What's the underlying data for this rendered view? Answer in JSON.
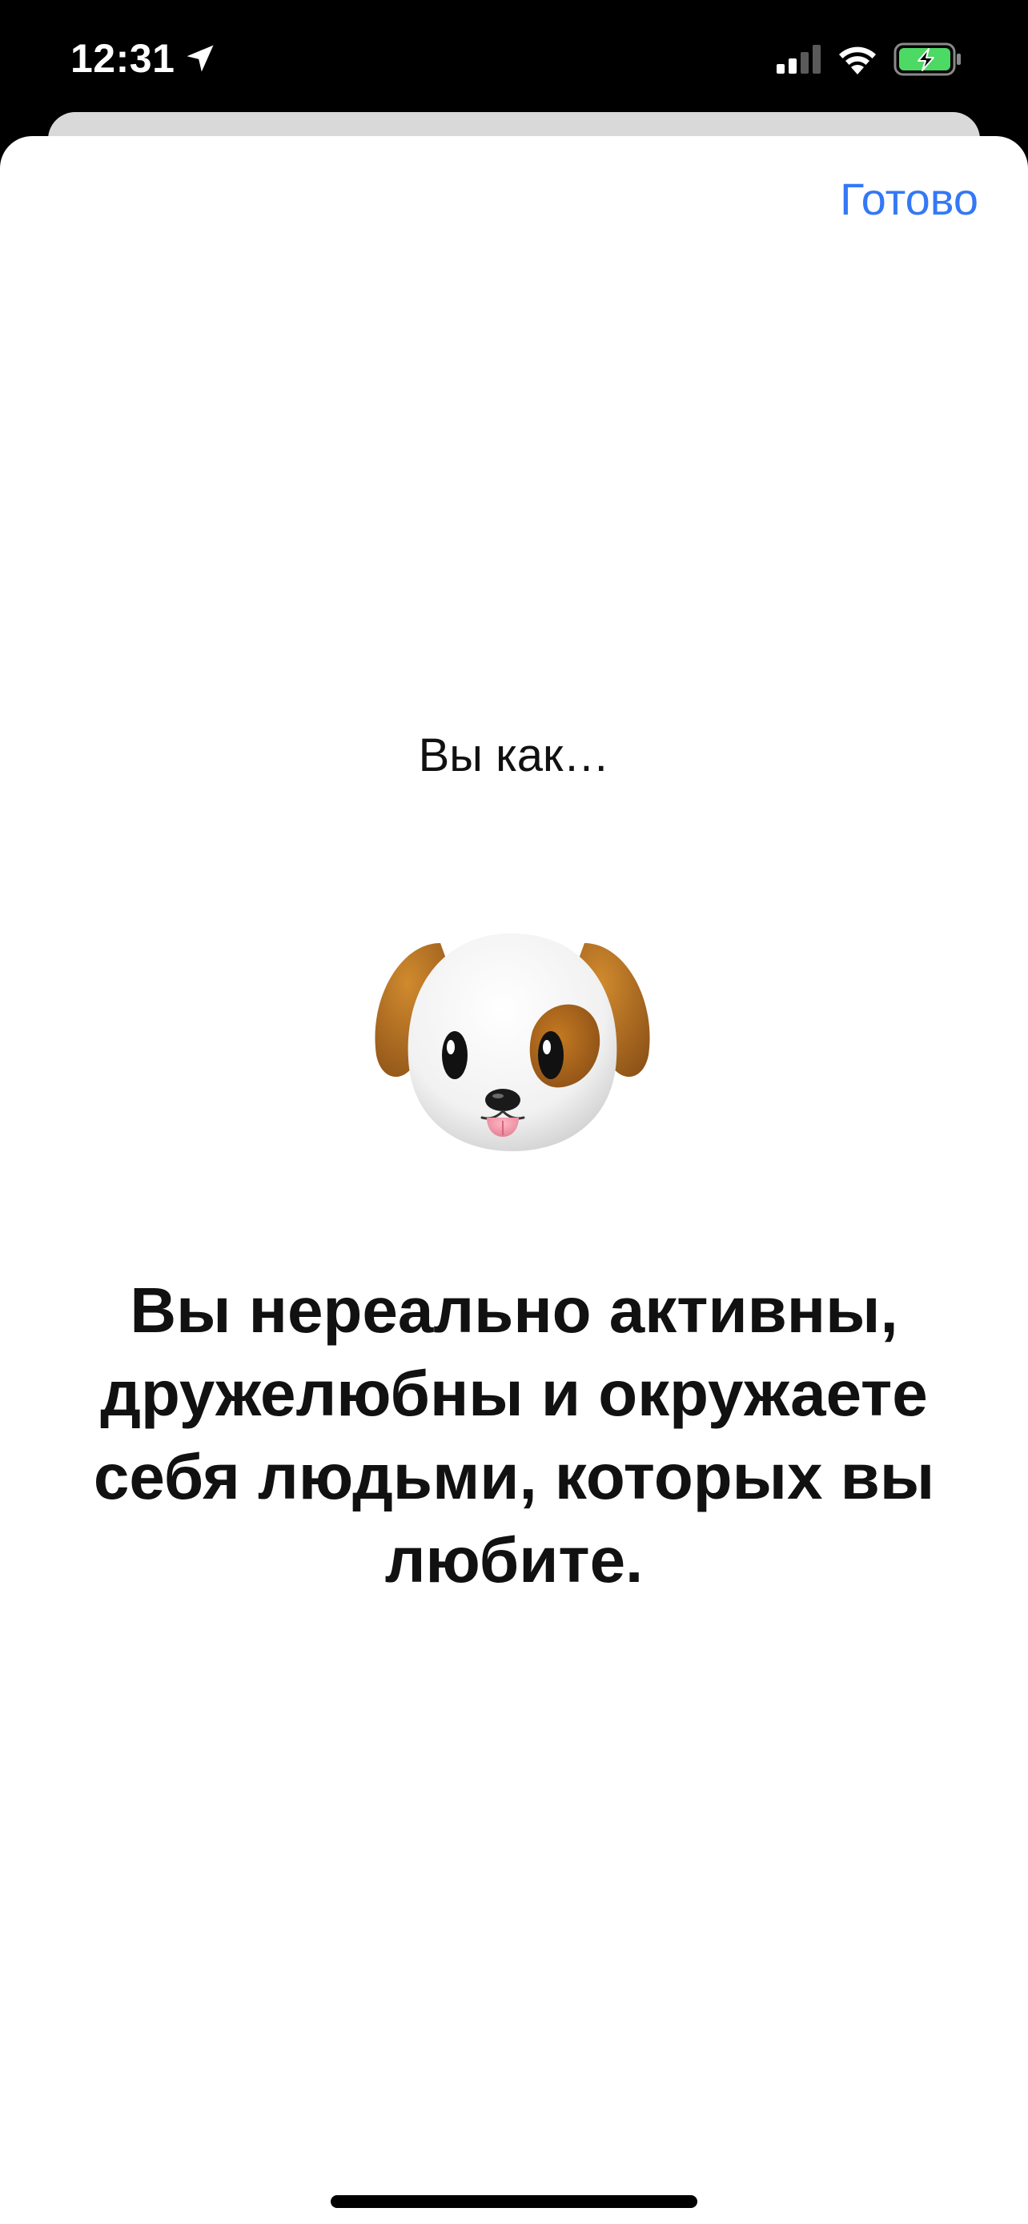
{
  "status_bar": {
    "time": "12:31",
    "icons": [
      "location-arrow-icon",
      "cellular-signal-icon",
      "wifi-icon",
      "battery-charging-icon"
    ],
    "battery_color": "#4cd964"
  },
  "sheet": {
    "done_label": "Готово",
    "accent_color": "#3478f6",
    "intro": "Вы как…",
    "animal_icon": "puppy-emoji",
    "result": "Вы нереально активны, дружелюбны и окружаете себя людьми, которых вы любите."
  }
}
